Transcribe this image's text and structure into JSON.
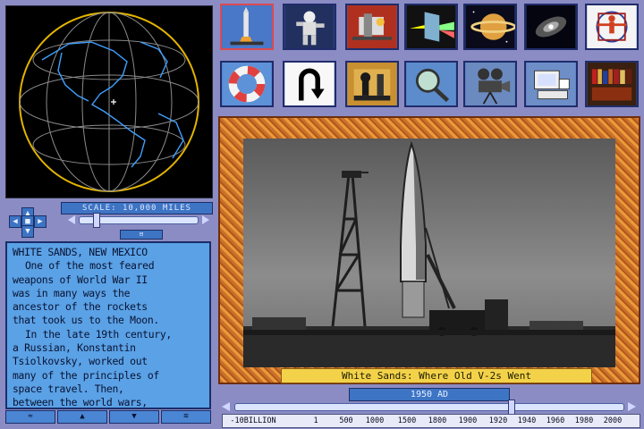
{
  "globe": {
    "scale_label": "SCALE: 10,000 MILES",
    "zoom_button": "⊟"
  },
  "text_panel": {
    "lines": [
      "WHITE SANDS, NEW MEXICO",
      "One of the most feared",
      "weapons of World War II",
      "was in many ways the",
      "ancestor of the rockets",
      "that took us to the Moon.",
      "In the late 19th century,",
      "a Russian, Konstantin",
      "Tsiolkovsky, worked out",
      "many of the principles of",
      "space travel. Then,",
      "between the world wars,"
    ],
    "scroll_buttons": [
      "≈",
      "▲",
      "▼",
      "≋"
    ]
  },
  "toolbar": {
    "icons": [
      {
        "name": "rocket-launch-icon"
      },
      {
        "name": "astronaut-icon"
      },
      {
        "name": "space-station-icon"
      },
      {
        "name": "prism-icon"
      },
      {
        "name": "saturn-icon"
      },
      {
        "name": "galaxy-icon"
      },
      {
        "name": "vitruvian-icon"
      },
      {
        "name": "life-preserver-icon"
      },
      {
        "name": "u-turn-back-icon"
      },
      {
        "name": "chess-pieces-icon"
      },
      {
        "name": "magnifier-icon"
      },
      {
        "name": "movie-camera-icon"
      },
      {
        "name": "computer-printer-icon"
      },
      {
        "name": "bookshelf-icon"
      }
    ]
  },
  "picture": {
    "caption": "White Sands: Where Old V-2s Went"
  },
  "timeline": {
    "year_label": "1950 AD",
    "position_fraction": 0.71,
    "ticks": [
      "-10BILLION",
      "1",
      "500",
      "1000",
      "1500",
      "1800",
      "1900",
      "1920",
      "1940",
      "1960",
      "1980",
      "2000"
    ]
  },
  "colors": {
    "panel_blue": "#3d74c4",
    "text_bg": "#5aa1e6",
    "frame_orange": "#e99a3a",
    "caption_yellow": "#f3d24a",
    "background": "#8b8cc4"
  }
}
